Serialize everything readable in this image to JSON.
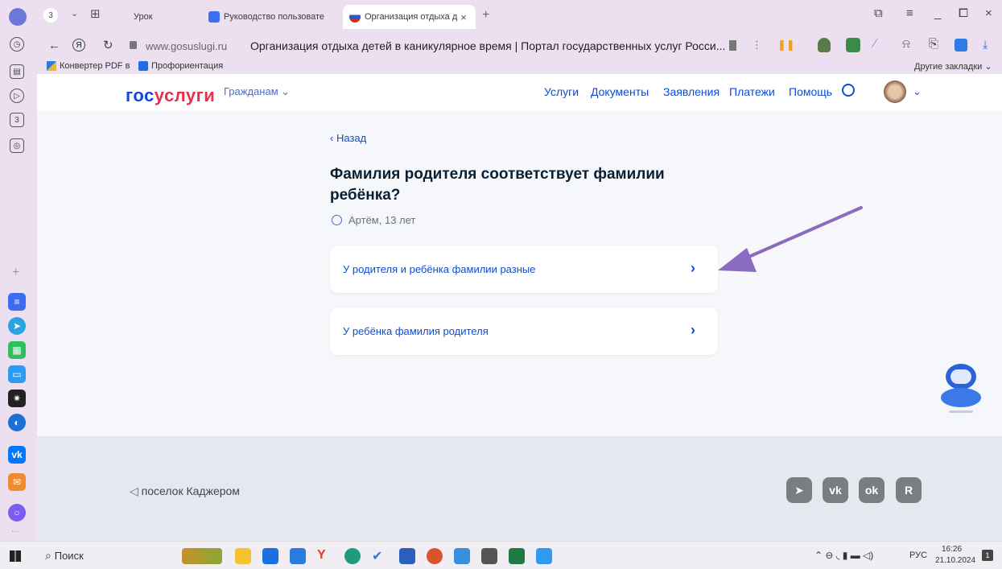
{
  "browser": {
    "tab_count": "3",
    "tabs": [
      {
        "label": "Урок"
      },
      {
        "label": "Руководство пользовате"
      },
      {
        "label": "Организация отдыха д"
      }
    ],
    "close_tab": "×",
    "new_tab": "+",
    "url_host": "www.gosuslugi.ru",
    "page_title": "Организация отдыха детей в каникулярное время | Портал государственных услуг Росси...",
    "bookmarks": [
      {
        "label": "Конвертер PDF в"
      },
      {
        "label": "Профориентация"
      }
    ],
    "other_bookmarks": "Другие закладки"
  },
  "header": {
    "logo_part1": "гос",
    "logo_part2": "услуги",
    "audience": "Гражданам",
    "nav": [
      "Услуги",
      "Документы",
      "Заявления",
      "Платежи",
      "Помощь"
    ]
  },
  "main": {
    "back": "Назад",
    "question": "Фамилия родителя соответствует фамилии ребёнка?",
    "child": "Артём, 13 лет",
    "options": [
      {
        "label": "У родителя и ребёнка фамилии разные"
      },
      {
        "label": "У ребёнка фамилия родителя"
      }
    ]
  },
  "footer": {
    "location": "поселок Каджером",
    "socials": [
      "telegram",
      "vk",
      "odnoklassniki",
      "rutube"
    ]
  },
  "taskbar": {
    "search": "Поиск",
    "lang": "РУС",
    "time": "16:26",
    "date": "21.10.2024",
    "notif": "1"
  },
  "colors": {
    "accent": "#0d4cd3",
    "logo_red": "#e7314a",
    "arrow": "#8b6bbf",
    "browser_frame": "#ecdfef"
  }
}
